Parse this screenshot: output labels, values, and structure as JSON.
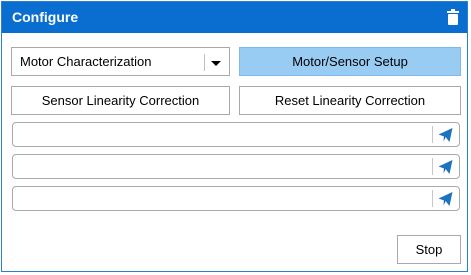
{
  "window": {
    "title": "Configure",
    "title_bar_color": "#0a6ed1"
  },
  "icons": {
    "delete": "trash-icon",
    "send": "paper-plane-icon",
    "dropdown": "chevron-down-icon"
  },
  "controls": {
    "mode_select": {
      "selected": "Motor Characterization"
    },
    "motor_sensor_setup_label": "Motor/Sensor Setup",
    "sensor_linearity_label": "Sensor Linearity Correction",
    "reset_linearity_label": "Reset Linearity Correction"
  },
  "command_inputs": [
    {
      "value": "",
      "placeholder": ""
    },
    {
      "value": "",
      "placeholder": ""
    },
    {
      "value": "",
      "placeholder": ""
    }
  ],
  "stop_label": "Stop",
  "colors": {
    "accent": "#0a6ed1",
    "selected_button": "#99ccf3",
    "icon_blue": "#1e73be"
  }
}
